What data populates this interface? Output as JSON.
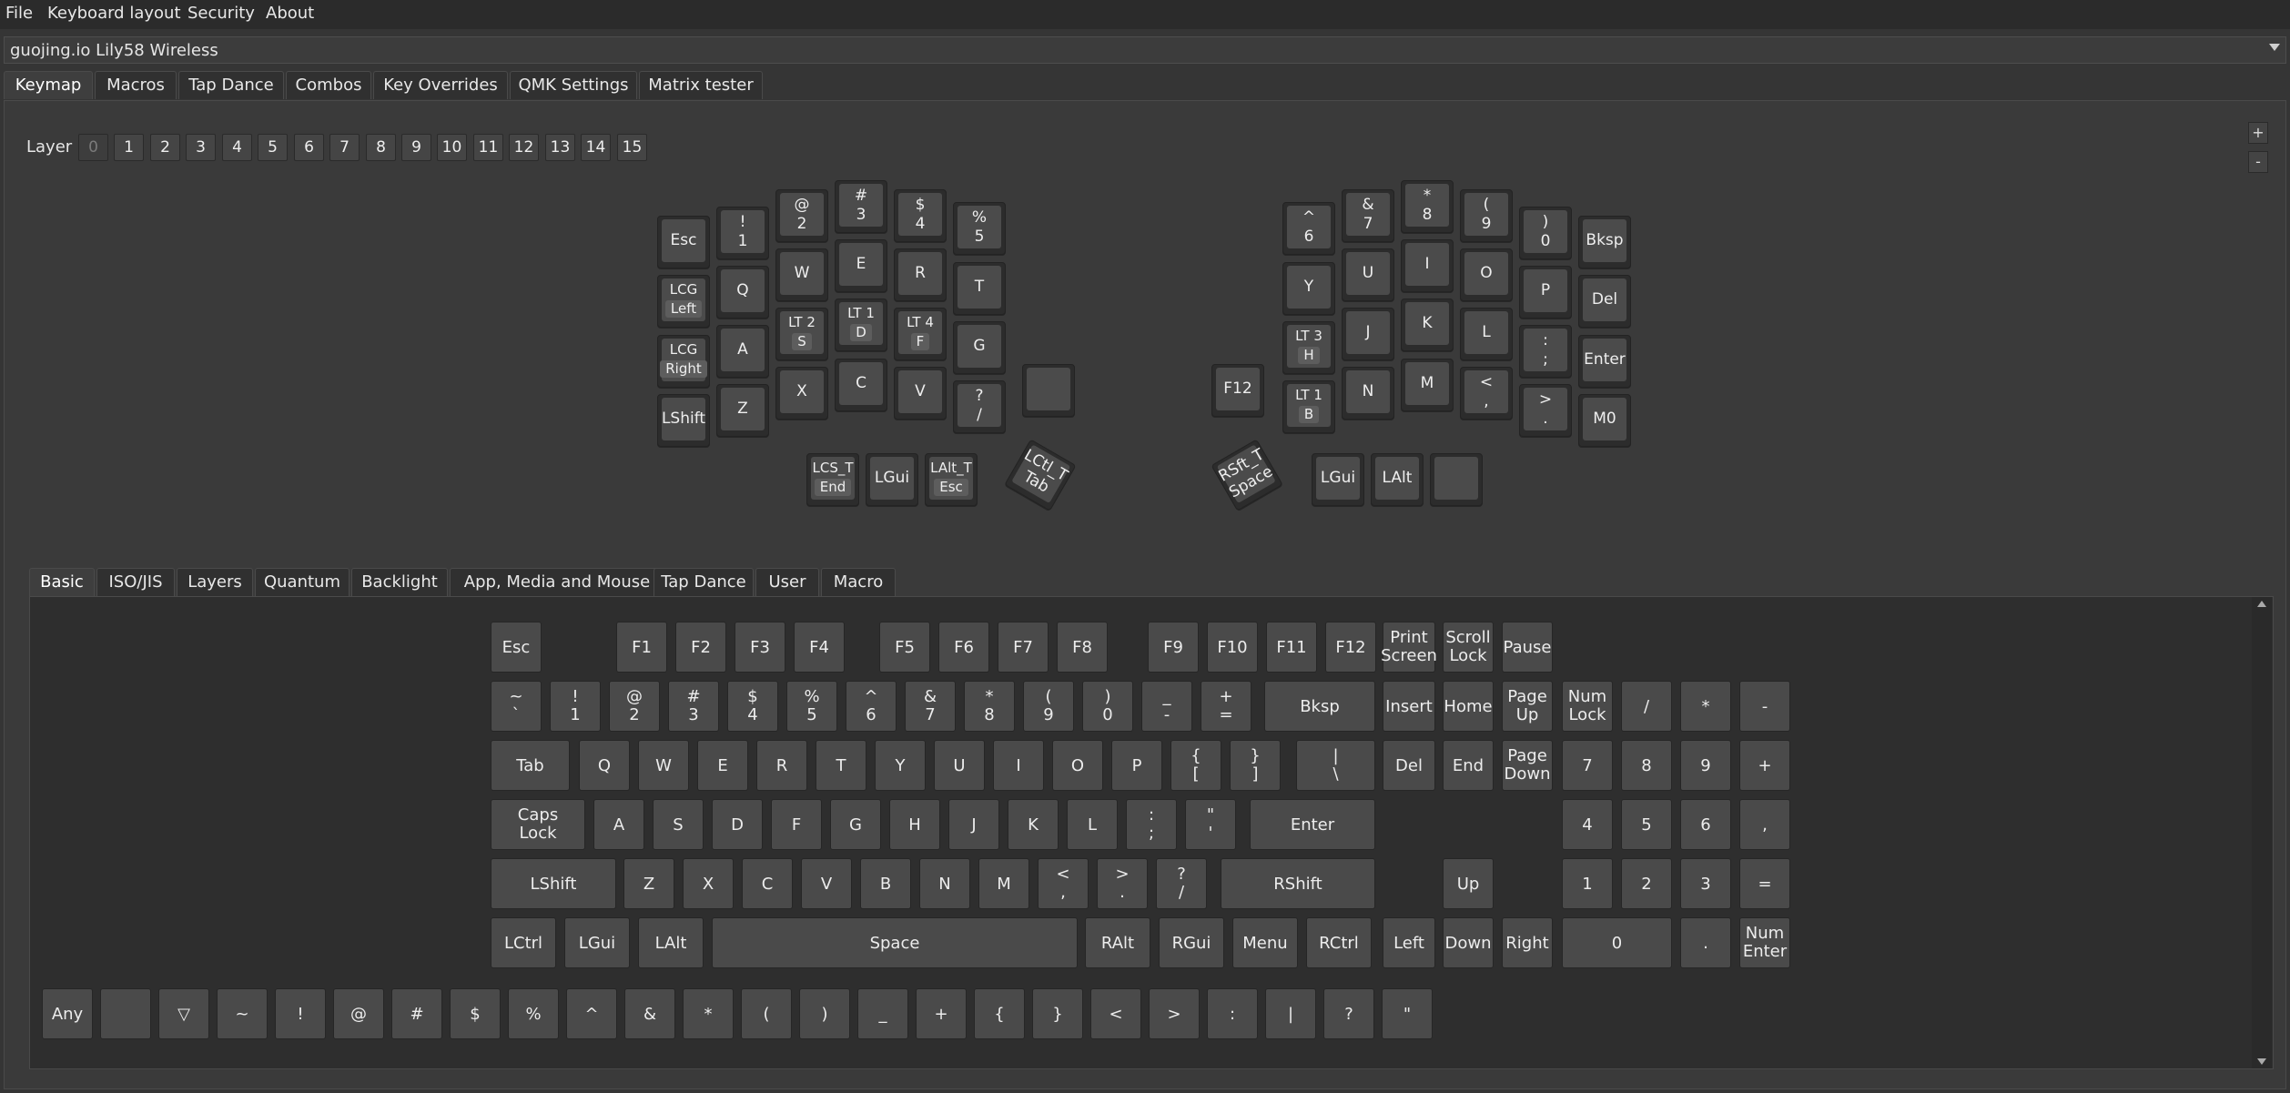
{
  "menu": [
    "File",
    "Keyboard layout",
    "Security",
    "About"
  ],
  "device": "guojing.io Lily58 Wireless",
  "main_tabs": [
    {
      "label": "Keymap",
      "active": true
    },
    {
      "label": "Macros"
    },
    {
      "label": "Tap Dance"
    },
    {
      "label": "Combos"
    },
    {
      "label": "Key Overrides"
    },
    {
      "label": "QMK Settings"
    },
    {
      "label": "Matrix tester"
    }
  ],
  "layer_label": "Layer",
  "layers": [
    "0",
    "1",
    "2",
    "3",
    "4",
    "5",
    "6",
    "7",
    "8",
    "9",
    "10",
    "11",
    "12",
    "13",
    "14",
    "15"
  ],
  "current_layer": "0",
  "zoom_in": "+",
  "zoom_out": "-",
  "keymap": [
    {
      "l1": "Esc"
    },
    {
      "l1": "!",
      "l2": "1"
    },
    {
      "l1": "@",
      "l2": "2"
    },
    {
      "l1": "#",
      "l2": "3"
    },
    {
      "l1": "$",
      "l2": "4"
    },
    {
      "l1": "%",
      "l2": "5"
    },
    {
      "l1": "LCG",
      "m": "Left"
    },
    {
      "l1": "Q"
    },
    {
      "l1": "W"
    },
    {
      "l1": "E"
    },
    {
      "l1": "R"
    },
    {
      "l1": "T"
    },
    {
      "l1": "LCG",
      "m": "Right"
    },
    {
      "l1": "A"
    },
    {
      "l1": "LT 2",
      "m": "S"
    },
    {
      "l1": "LT 1",
      "m": "D"
    },
    {
      "l1": "LT 4",
      "m": "F"
    },
    {
      "l1": "G"
    },
    {
      "l1": "LShift"
    },
    {
      "l1": "Z"
    },
    {
      "l1": "X"
    },
    {
      "l1": "C"
    },
    {
      "l1": "V"
    },
    {
      "l1": "?",
      "l2": "/"
    },
    {
      "l1": ""
    },
    {
      "l1": "LCS_T",
      "m": "End"
    },
    {
      "l1": "LGui"
    },
    {
      "l1": "LAlt_T",
      "m": "Esc"
    },
    {
      "l1": "LCtl_T",
      "l2": "Tab"
    },
    {
      "l1": "^",
      "l2": "6"
    },
    {
      "l1": "&",
      "l2": "7"
    },
    {
      "l1": "*",
      "l2": "8"
    },
    {
      "l1": "(",
      "l2": "9"
    },
    {
      "l1": ")",
      "l2": "0"
    },
    {
      "l1": "Bksp"
    },
    {
      "l1": "Y"
    },
    {
      "l1": "U"
    },
    {
      "l1": "I"
    },
    {
      "l1": "O"
    },
    {
      "l1": "P"
    },
    {
      "l1": "Del"
    },
    {
      "l1": "LT 3",
      "m": "H"
    },
    {
      "l1": "J"
    },
    {
      "l1": "K"
    },
    {
      "l1": "L"
    },
    {
      "l1": ":",
      "l2": ";"
    },
    {
      "l1": "Enter"
    },
    {
      "l1": "F12"
    },
    {
      "l1": "LT 1",
      "m": "B"
    },
    {
      "l1": "N"
    },
    {
      "l1": "M"
    },
    {
      "l1": "<",
      "l2": ","
    },
    {
      "l1": ">",
      "l2": "."
    },
    {
      "l1": "M0"
    },
    {
      "l1": "RSft_T",
      "l2": "Space"
    },
    {
      "l1": "LGui"
    },
    {
      "l1": "LAlt"
    },
    {
      "l1": ""
    }
  ],
  "keycode_tabs": [
    {
      "label": "Basic",
      "active": true
    },
    {
      "label": "ISO/JIS"
    },
    {
      "label": "Layers"
    },
    {
      "label": "Quantum"
    },
    {
      "label": "Backlight"
    },
    {
      "label": "App, Media and Mouse"
    },
    {
      "label": "Tap Dance"
    },
    {
      "label": "User"
    },
    {
      "label": "Macro"
    }
  ],
  "basic_keys": [
    {
      "l1": "Esc"
    },
    {
      "l1": "F1"
    },
    {
      "l1": "F2"
    },
    {
      "l1": "F3"
    },
    {
      "l1": "F4"
    },
    {
      "l1": "F5"
    },
    {
      "l1": "F6"
    },
    {
      "l1": "F7"
    },
    {
      "l1": "F8"
    },
    {
      "l1": "F9"
    },
    {
      "l1": "F10"
    },
    {
      "l1": "F11"
    },
    {
      "l1": "F12"
    },
    {
      "l1": "Print",
      "l2": "Screen"
    },
    {
      "l1": "Scroll",
      "l2": "Lock"
    },
    {
      "l1": "Pause"
    },
    {
      "l1": "~",
      "l2": "`"
    },
    {
      "l1": "!",
      "l2": "1"
    },
    {
      "l1": "@",
      "l2": "2"
    },
    {
      "l1": "#",
      "l2": "3"
    },
    {
      "l1": "$",
      "l2": "4"
    },
    {
      "l1": "%",
      "l2": "5"
    },
    {
      "l1": "^",
      "l2": "6"
    },
    {
      "l1": "&",
      "l2": "7"
    },
    {
      "l1": "*",
      "l2": "8"
    },
    {
      "l1": "(",
      "l2": "9"
    },
    {
      "l1": ")",
      "l2": "0"
    },
    {
      "l1": "_",
      "l2": "-"
    },
    {
      "l1": "+",
      "l2": "="
    },
    {
      "l1": "Bksp"
    },
    {
      "l1": "Insert"
    },
    {
      "l1": "Home"
    },
    {
      "l1": "Page",
      "l2": "Up"
    },
    {
      "l1": "Num",
      "l2": "Lock"
    },
    {
      "l1": "/"
    },
    {
      "l1": "*"
    },
    {
      "l1": "-"
    },
    {
      "l1": "Tab"
    },
    {
      "l1": "Q"
    },
    {
      "l1": "W"
    },
    {
      "l1": "E"
    },
    {
      "l1": "R"
    },
    {
      "l1": "T"
    },
    {
      "l1": "Y"
    },
    {
      "l1": "U"
    },
    {
      "l1": "I"
    },
    {
      "l1": "O"
    },
    {
      "l1": "P"
    },
    {
      "l1": "{",
      "l2": "["
    },
    {
      "l1": "}",
      "l2": "]"
    },
    {
      "l1": "|",
      "l2": "\\"
    },
    {
      "l1": "Del"
    },
    {
      "l1": "End"
    },
    {
      "l1": "Page",
      "l2": "Down"
    },
    {
      "l1": "7"
    },
    {
      "l1": "8"
    },
    {
      "l1": "9"
    },
    {
      "l1": "+"
    },
    {
      "l1": "Caps",
      "l2": "Lock"
    },
    {
      "l1": "A"
    },
    {
      "l1": "S"
    },
    {
      "l1": "D"
    },
    {
      "l1": "F"
    },
    {
      "l1": "G"
    },
    {
      "l1": "H"
    },
    {
      "l1": "J"
    },
    {
      "l1": "K"
    },
    {
      "l1": "L"
    },
    {
      "l1": ":",
      "l2": ";"
    },
    {
      "l1": "\"",
      "l2": "'"
    },
    {
      "l1": "Enter"
    },
    {
      "l1": "4"
    },
    {
      "l1": "5"
    },
    {
      "l1": "6"
    },
    {
      "l1": ","
    },
    {
      "l1": "LShift"
    },
    {
      "l1": "Z"
    },
    {
      "l1": "X"
    },
    {
      "l1": "C"
    },
    {
      "l1": "V"
    },
    {
      "l1": "B"
    },
    {
      "l1": "N"
    },
    {
      "l1": "M"
    },
    {
      "l1": "<",
      "l2": ","
    },
    {
      "l1": ">",
      "l2": "."
    },
    {
      "l1": "?",
      "l2": "/"
    },
    {
      "l1": "RShift"
    },
    {
      "l1": "Up"
    },
    {
      "l1": "1"
    },
    {
      "l1": "2"
    },
    {
      "l1": "3"
    },
    {
      "l1": "="
    },
    {
      "l1": "LCtrl"
    },
    {
      "l1": "LGui"
    },
    {
      "l1": "LAlt"
    },
    {
      "l1": "Space"
    },
    {
      "l1": "RAlt"
    },
    {
      "l1": "RGui"
    },
    {
      "l1": "Menu"
    },
    {
      "l1": "RCtrl"
    },
    {
      "l1": "Left"
    },
    {
      "l1": "Down"
    },
    {
      "l1": "Right"
    },
    {
      "l1": "0"
    },
    {
      "l1": "."
    },
    {
      "l1": "Num",
      "l2": "Enter"
    }
  ],
  "shifted_keys": [
    "Any",
    "",
    "▽",
    "~",
    "!",
    "@",
    "#",
    "$",
    "%",
    "^",
    "&",
    "*",
    "(",
    ")",
    "_",
    "+",
    "{",
    "}",
    "<",
    ">",
    ":",
    "|",
    "?",
    "\""
  ]
}
